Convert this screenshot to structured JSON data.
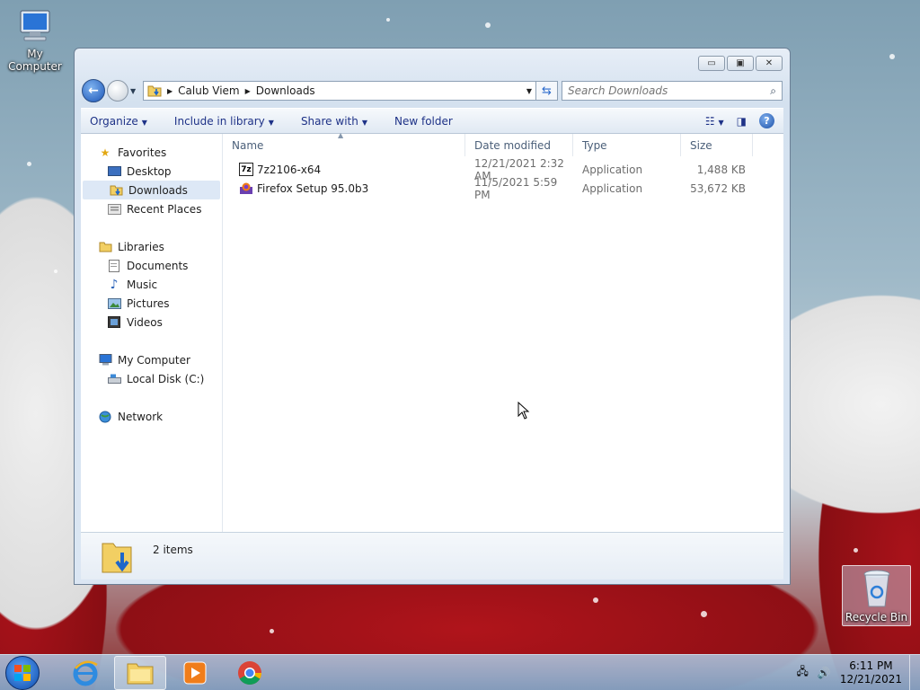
{
  "desktop": {
    "icons": [
      {
        "label": "My Computer",
        "icon": "computer-icon"
      },
      {
        "label": "Recycle Bin",
        "icon": "recycle-bin-icon"
      }
    ]
  },
  "window": {
    "controls": {
      "minimize": "minimize-icon",
      "maximize": "restore-icon",
      "close": "close-icon"
    },
    "address": {
      "segments": [
        "Calub Viem",
        "Downloads"
      ]
    },
    "search": {
      "placeholder": "Search Downloads"
    },
    "toolbar": {
      "organize": "Organize",
      "include_in_library": "Include in library",
      "share_with": "Share with",
      "new_folder": "New folder"
    },
    "nav": {
      "favorites": {
        "label": "Favorites",
        "items": [
          "Desktop",
          "Downloads",
          "Recent Places"
        ],
        "selected": "Downloads"
      },
      "libraries": {
        "label": "Libraries",
        "items": [
          "Documents",
          "Music",
          "Pictures",
          "Videos"
        ]
      },
      "computer": {
        "label": "My Computer",
        "items": [
          "Local Disk (C:)"
        ]
      },
      "network": {
        "label": "Network"
      }
    },
    "columns": {
      "name": "Name",
      "date": "Date modified",
      "type": "Type",
      "size": "Size"
    },
    "files": [
      {
        "name": "7z2106-x64",
        "date": "12/21/2021 2:32 AM",
        "type": "Application",
        "size": "1,488 KB",
        "icon": "7zip-icon"
      },
      {
        "name": "Firefox Setup 95.0b3",
        "date": "11/5/2021 5:59 PM",
        "type": "Application",
        "size": "53,672 KB",
        "icon": "firefox-installer-icon"
      }
    ],
    "details": {
      "count": "2 items"
    }
  },
  "taskbar": {
    "apps": [
      "Internet Explorer",
      "Windows Explorer",
      "Windows Media Player",
      "Google Chrome"
    ],
    "clock": {
      "time": "6:11 PM",
      "date": "12/21/2021"
    }
  },
  "colors": {
    "accent": "#1e3287",
    "selection": "#dde8f6",
    "taskbar": "#9cbcd8"
  }
}
